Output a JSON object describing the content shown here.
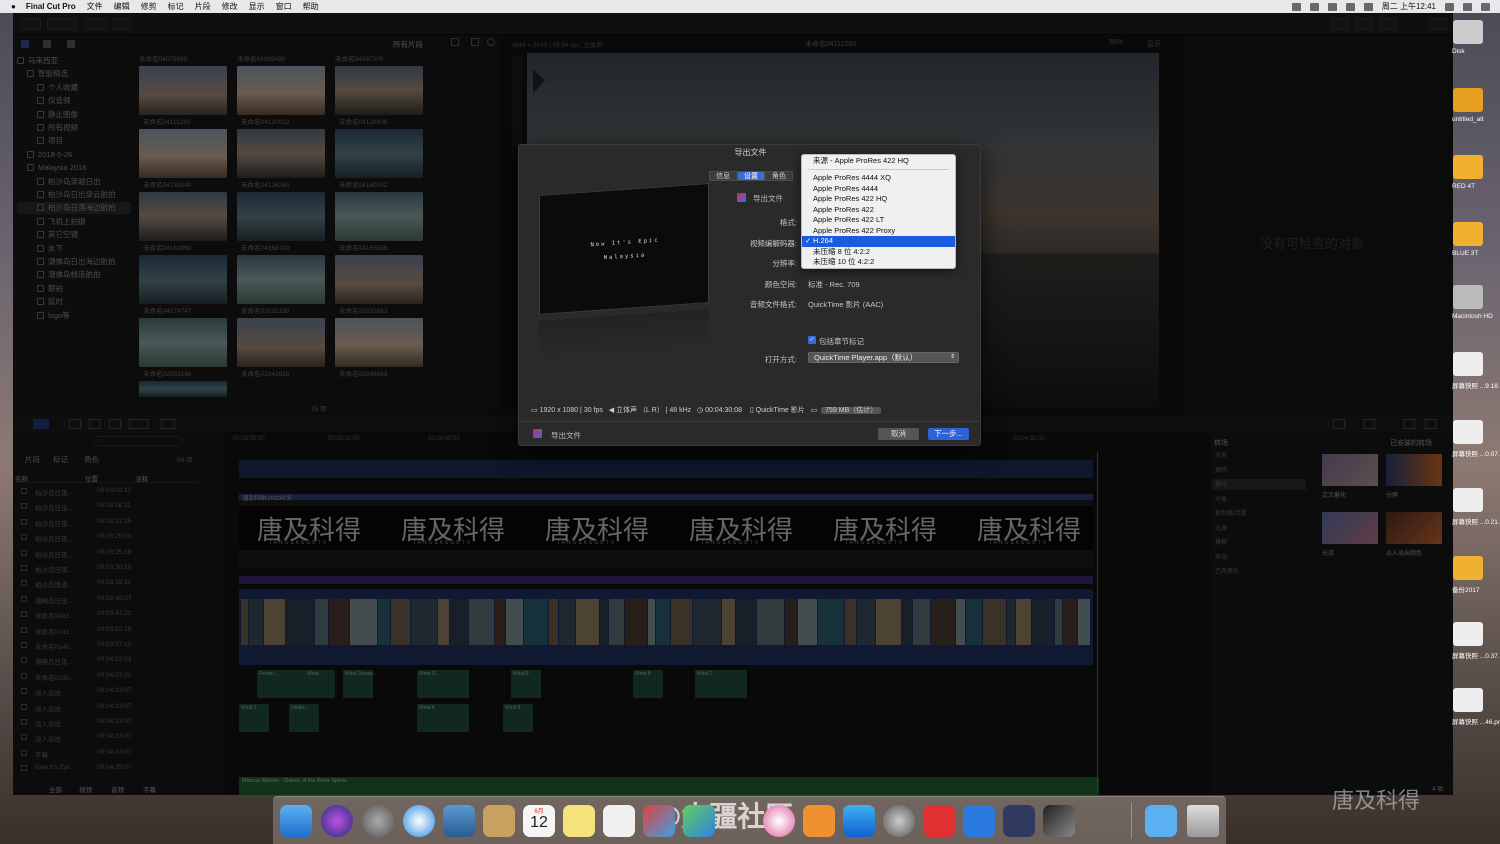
{
  "menubar": {
    "app": "Final Cut Pro",
    "items": [
      "文件",
      "编辑",
      "修剪",
      "标记",
      "片段",
      "修改",
      "显示",
      "窗口",
      "帮助"
    ],
    "clock": "周二 上午12:41"
  },
  "browser": {
    "filter": "所有片段",
    "info": "3644 × 2048 | 59.94 fps, 立体声",
    "count": "25 项"
  },
  "library": {
    "items": [
      {
        "label": "马来西亚",
        "indent": 0
      },
      {
        "label": "智能精选",
        "indent": 1
      },
      {
        "label": "个人收藏",
        "indent": 2
      },
      {
        "label": "仅音频",
        "indent": 2
      },
      {
        "label": "静止图像",
        "indent": 2
      },
      {
        "label": "所有视频",
        "indent": 2
      },
      {
        "label": "项目",
        "indent": 2
      },
      {
        "label": "2018-5-26",
        "indent": 1
      },
      {
        "label": "Malaysia 2018",
        "indent": 1
      },
      {
        "label": "柏沙岛穿越日出",
        "indent": 2
      },
      {
        "label": "柏沙岛日出穿云航拍",
        "indent": 2
      },
      {
        "label": "柏沙岛日落海边航拍",
        "indent": 2,
        "selected": true
      },
      {
        "label": "飞机上拍摄",
        "indent": 2
      },
      {
        "label": "其它空镜",
        "indent": 2
      },
      {
        "label": "水下",
        "indent": 2
      },
      {
        "label": "潮佛岛日出海边航拍",
        "indent": 2
      },
      {
        "label": "潮佛岛栈道航拍",
        "indent": 2
      },
      {
        "label": "跟拍",
        "indent": 2
      },
      {
        "label": "延时",
        "indent": 2
      },
      {
        "label": "logo等",
        "indent": 2
      }
    ]
  },
  "thumbs": {
    "top_labels": [
      "未命名04078980",
      "未命名04089480",
      "未命名04097200"
    ],
    "rows": [
      [
        "未命名04111260",
        "未命名04120032",
        "未命名04126639"
      ],
      [
        "未命名04133340",
        "未命名04136260",
        "未命名04160002"
      ],
      [
        "未命名04161960",
        "未命名04168740",
        "未命名04165596"
      ],
      [
        "未命名04174747",
        "未命名02025180",
        "未命名02031683"
      ],
      [
        "未命名02033186",
        "未命名02042810",
        "未命名02046563"
      ]
    ]
  },
  "viewer": {
    "clip": "未命名04111260",
    "zoom": "56%",
    "view": "显示"
  },
  "inspector": {
    "empty": "没有可检查的对象"
  },
  "dialog": {
    "title": "导出文件",
    "tabs": [
      "信息",
      "设置",
      "角色"
    ],
    "destination": "导出文件",
    "labels": {
      "format": "格式:",
      "codec": "视频编解码器:",
      "resolution": "分辨率:",
      "color_space": "颜色空间:",
      "audio_format": "音频文件格式:",
      "open_with": "打开方式:"
    },
    "color_space_value": "标准 - Rec. 709",
    "audio_format_value": "QuickTime 影片 (AAC)",
    "chapters_label": "包括章节标记",
    "open_with_value": "QuickTime Player.app（默认）",
    "preview_line1": "Now It's Epic",
    "preview_line2": "Malaysia",
    "status": {
      "resolution": "1920 x 1080 | 30 fps",
      "audio": "立体声 （L R） | 48 kHz",
      "duration": "00:04:30:08",
      "container": "QuickTime 影片",
      "size": "759 MB（估计）"
    },
    "footer_dest": "导出文件",
    "cancel": "取消",
    "next": "下一步..."
  },
  "codec_menu": {
    "source": "来源 - Apple ProRes 422 HQ",
    "items": [
      "Apple ProRes 4444 XQ",
      "Apple ProRes 4444",
      "Apple ProRes 422 HQ",
      "Apple ProRes 422",
      "Apple ProRes 422 LT",
      "Apple ProRes 422 Proxy",
      "H.264",
      "未压缩 8 位 4:2:2",
      "未压缩 10 位 4:2:2"
    ],
    "selected": "H.264",
    "check": "✓"
  },
  "timeline_index": {
    "tabs": [
      "片段",
      "标记",
      "角色"
    ],
    "count": "69 项",
    "columns": [
      "名称",
      "位置",
      "注释"
    ],
    "rows": [
      [
        "柏沙岛日落...",
        "00:03:03:12"
      ],
      [
        "柏沙岛日出...",
        "00:03:08:11"
      ],
      [
        "柏沙岛日落...",
        "00:03:13:15"
      ],
      [
        "柏沙岛日落...",
        "00:03:20:00"
      ],
      [
        "柏沙岛日落...",
        "00:03:25:18"
      ],
      [
        "柏沙岛日落...",
        "00:03:30:10"
      ],
      [
        "柏沙岛栈道...",
        "00:03:35:11"
      ],
      [
        "潮佛岛日出...",
        "00:03:40:07"
      ],
      [
        "未命名0083...",
        "00:03:47:22"
      ],
      [
        "未命名0141...",
        "00:03:52:19"
      ],
      [
        "未命名0140...",
        "00:03:57:10"
      ],
      [
        "潮佛岛日落...",
        "00:04:02:03"
      ],
      [
        "未命名0150...",
        "00:04:07:02"
      ],
      [
        "淡入淡出",
        "00:04:23:07"
      ],
      [
        "淡入淡出",
        "00:04:23:07"
      ],
      [
        "淡入淡出",
        "00:04:23:07"
      ],
      [
        "淡入淡出",
        "00:04:23:07"
      ],
      [
        "字幕",
        "00:04:24:07"
      ],
      [
        "Now It's Epi...",
        "00:04:25:07"
      ]
    ],
    "bottom_tabs": [
      "全部",
      "视频",
      "音频",
      "字幕"
    ]
  },
  "timeline": {
    "title_clip": "唐及科得LOGO片头",
    "watermark": "唐及科得",
    "watermark_sub": "TANG&KEGETV",
    "audio_label": "Marcus Warner - Dance of the River Spirits",
    "ruler": [
      "00:03:00:00",
      "00:03:30:00",
      "00:04:00:00",
      "00:04:30:00"
    ],
    "audio_clips": [
      "Ferrari...",
      "Wind...",
      "Wind Ocean...",
      "Wind O...",
      "Wind 9",
      "Wind 8",
      "Wind 2",
      "Wind 3",
      "Under...",
      "Wind 4",
      "Wind 8"
    ]
  },
  "effects": {
    "title": "转场",
    "installed": "已安装的转场",
    "categories": [
      "全部",
      "擦除",
      "叠化",
      "对象",
      "复制器/克隆",
      "光源",
      "模糊",
      "移动",
      "已风格化"
    ],
    "items": [
      "交叉叠化",
      "分屏",
      "光流",
      "淡入淡出颜色"
    ],
    "count": "4 项"
  },
  "desktop_icons": [
    "Disk",
    "untitled_alt",
    "RED 4T",
    "BLUE 3T",
    "Macintosh HD",
    "屏幕快照 ...9.18.png",
    "屏幕快照 ...0.07.png",
    "屏幕快照 ...0.21.png",
    "备份2017",
    "屏幕快照 ...0.37.png",
    "屏幕快照 ...46.png"
  ],
  "overlay_watermark": "@大疆社区",
  "corner_logo": "唐及科得",
  "dock": {
    "calendar_month": "6月",
    "calendar_day": "12"
  }
}
